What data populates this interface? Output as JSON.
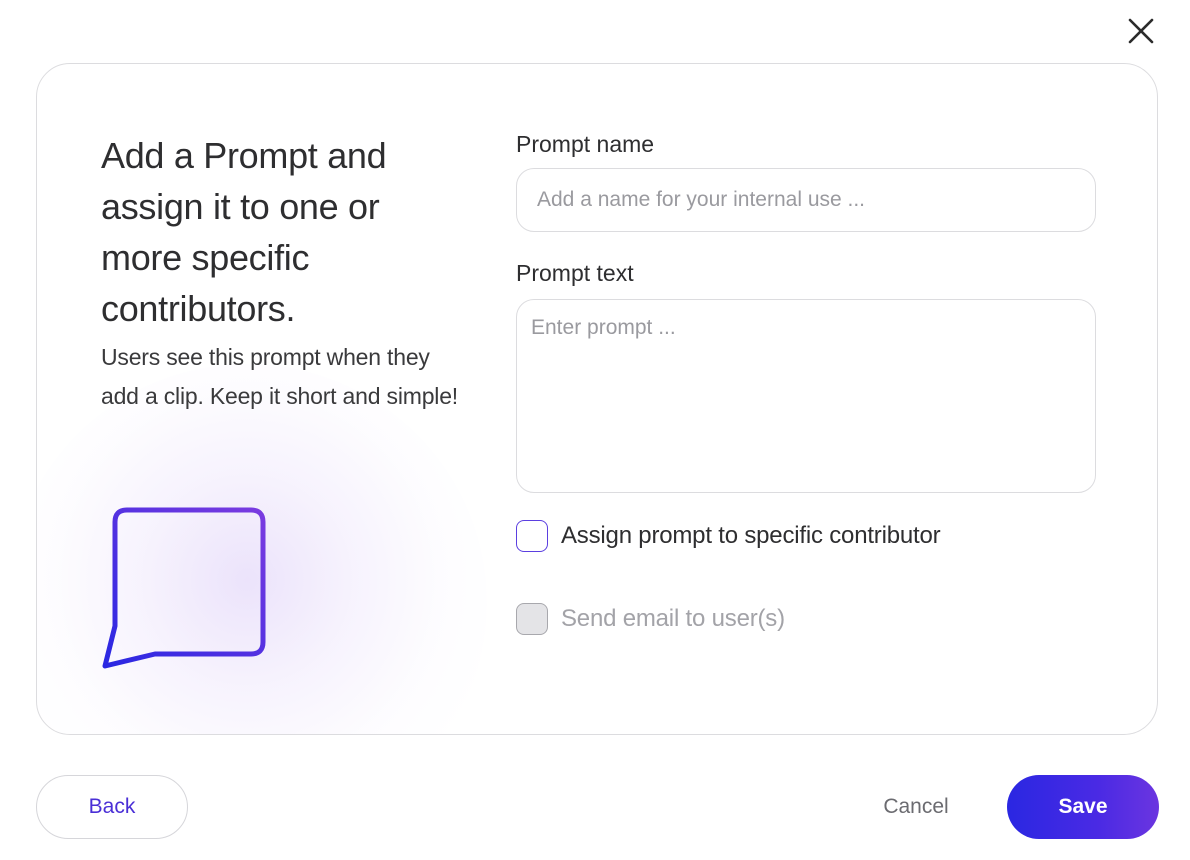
{
  "dialog": {
    "close_icon": "close-icon",
    "heading": "Add a Prompt and assign it to one or more specific contributors.",
    "description": "Users see this prompt when they add a clip. Keep it short and simple!",
    "illustration_icon": "chat-bubble-icon"
  },
  "form": {
    "prompt_name": {
      "label": "Prompt name",
      "value": "",
      "placeholder": "Add a name for your internal use ..."
    },
    "prompt_text": {
      "label": "Prompt text",
      "value": "",
      "placeholder": "Enter prompt ..."
    },
    "assign_checkbox": {
      "label": "Assign prompt to specific contributor",
      "checked": false,
      "disabled": false
    },
    "email_checkbox": {
      "label": "Send email to user(s)",
      "checked": false,
      "disabled": true
    }
  },
  "footer": {
    "back_label": "Back",
    "cancel_label": "Cancel",
    "save_label": "Save"
  },
  "colors": {
    "accent": "#4a2fd6",
    "save_gradient_start": "#2a27e2",
    "save_gradient_end": "#6b35e0",
    "border": "#dcdcdf",
    "placeholder": "#9a9a9f",
    "disabled_text": "#a3a3a8"
  }
}
